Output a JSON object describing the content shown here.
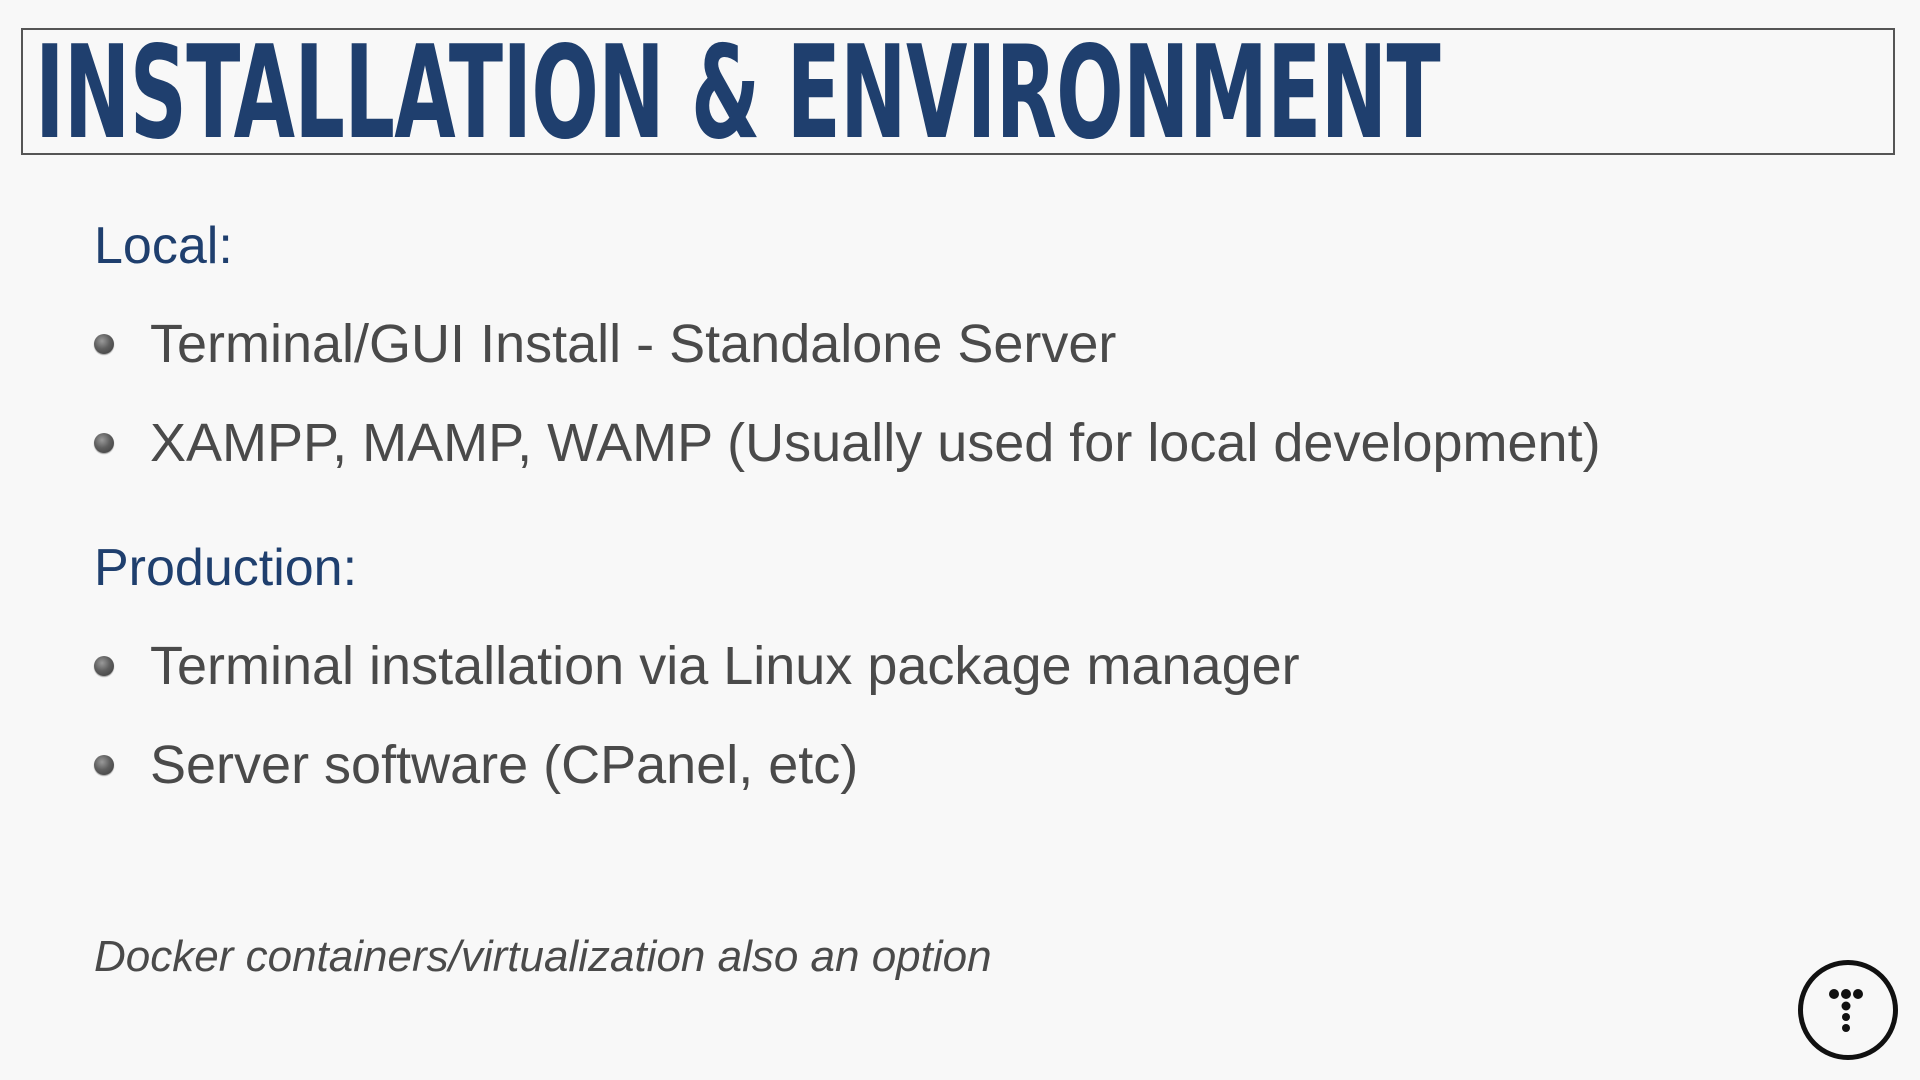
{
  "slide": {
    "title": "INSTALLATION & ENVIRONMENT",
    "sections": [
      {
        "heading": "Local:",
        "bullets": [
          "Terminal/GUI Install - Standalone Server",
          "XAMPP, MAMP, WAMP (Usually used for local development)"
        ]
      },
      {
        "heading": "Production:",
        "bullets": [
          "Terminal installation via Linux package manager",
          "Server software (CPanel, etc)"
        ]
      }
    ],
    "note": "Docker containers/virtualization also an option"
  },
  "logo": {
    "icon": "dotted-t-logo-icon"
  },
  "colors": {
    "heading": "#1f3f6e",
    "body_text": "#4a4a4a",
    "background": "#f8f8f8"
  }
}
